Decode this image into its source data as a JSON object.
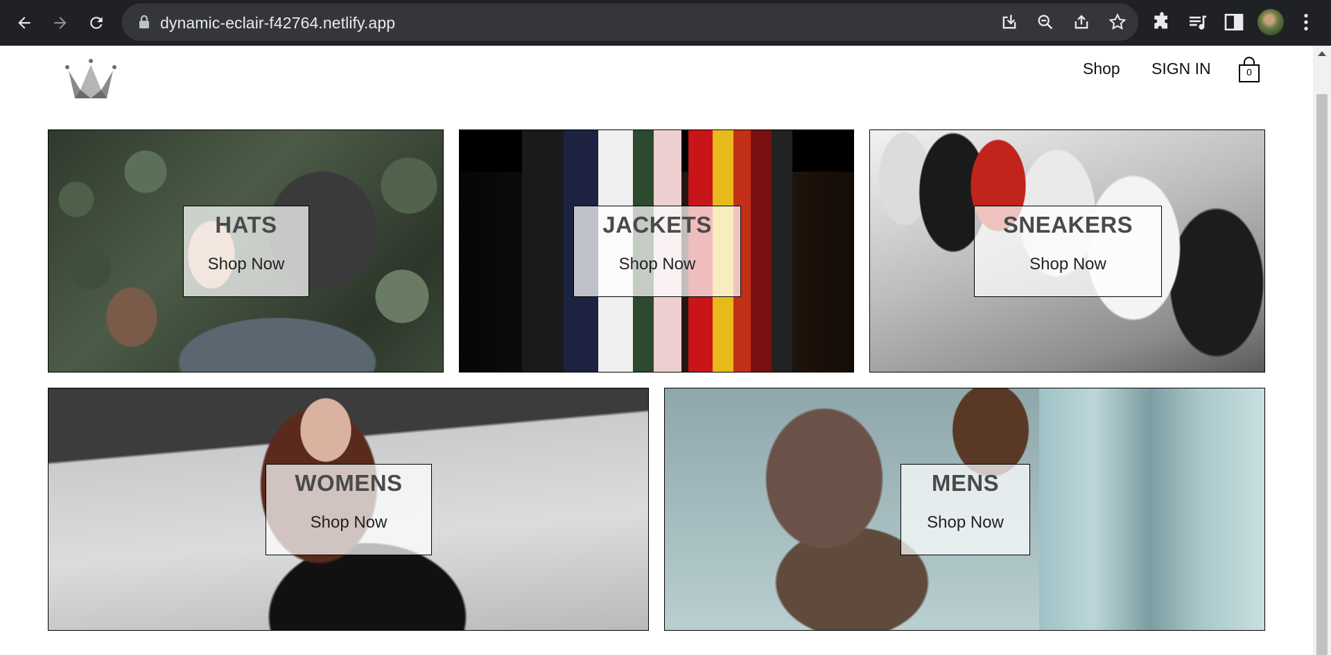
{
  "browser": {
    "url": "dynamic-eclair-f42764.netlify.app"
  },
  "header": {
    "nav": {
      "shop_label": "Shop",
      "signin_label": "SIGN IN"
    },
    "cart_count": "0"
  },
  "categories": [
    {
      "title": "HATS",
      "cta": "Shop Now"
    },
    {
      "title": "JACKETS",
      "cta": "Shop Now"
    },
    {
      "title": "SNEAKERS",
      "cta": "Shop Now"
    },
    {
      "title": "WOMENS",
      "cta": "Shop Now"
    },
    {
      "title": "MENS",
      "cta": "Shop Now"
    }
  ]
}
